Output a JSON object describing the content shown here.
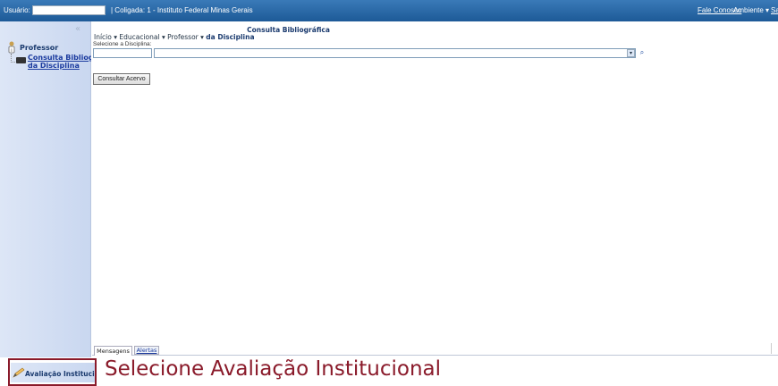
{
  "topbar": {
    "user_label": "Usuário:",
    "user_value": "",
    "coligada": "| Coligada: 1 - Instituto Federal Minas Gerais",
    "fale_conosco": "Fale Conosco",
    "ambiente": "Ambiente ▾",
    "sair": "Sa"
  },
  "sidebar": {
    "collapse_glyph": "«",
    "professor": "Professor",
    "consulta_line1": "Consulta Bibliogr",
    "consulta_line2": "da Disciplina"
  },
  "main": {
    "breadcrumb": "Início ▾  Educacional ▾  Professor ▾",
    "title_line1": "Consulta Bibliográfica",
    "title_line2": "da Disciplina",
    "field_label": "Selecione a Disciplina:",
    "code_value": "",
    "discipline_value": "",
    "dropdown_glyph": "▾",
    "lookup_glyph": "⌕",
    "consultar_button": "Consultar Acervo"
  },
  "tabs": {
    "mensagens": "Mensagens",
    "alertas": "Alertas"
  },
  "bottom": {
    "aval_item": "Avaliação Instituci",
    "caption": "Selecione Avaliação Institucional",
    "highlight_color": "#8a1a2a"
  },
  "colors": {
    "topbar": "#1d5a97",
    "sidebar": "#c9d7f0",
    "link": "#1a3a9e"
  }
}
